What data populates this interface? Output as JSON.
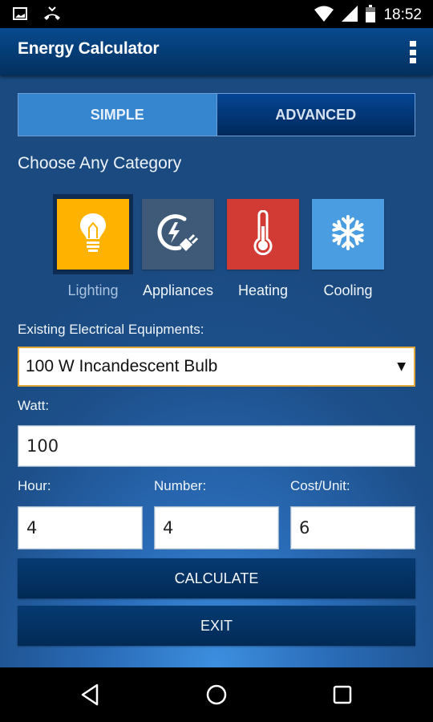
{
  "status_bar": {
    "time": "18:52",
    "left_icons": [
      "image-notification-icon",
      "missed-call-icon"
    ],
    "right_icons": [
      "wifi-icon",
      "signal-icon",
      "battery-icon"
    ]
  },
  "app_bar": {
    "title": "Energy Calculator",
    "menu_icon": "overflow-menu-icon"
  },
  "tabs": [
    {
      "label": "SIMPLE",
      "active": true
    },
    {
      "label": "ADVANCED",
      "active": false
    }
  ],
  "category_section": {
    "heading": "Choose Any Category",
    "categories": [
      {
        "label": "Lighting",
        "icon": "lightbulb-icon",
        "color": "#ffb300",
        "selected": true
      },
      {
        "label": "Appliances",
        "icon": "power-plug-icon",
        "color": "#3e5a78",
        "selected": false
      },
      {
        "label": "Heating",
        "icon": "thermometer-icon",
        "color": "#d23b33",
        "selected": false
      },
      {
        "label": "Cooling",
        "icon": "snowflake-icon",
        "color": "#4a9de0",
        "selected": false
      }
    ]
  },
  "form": {
    "equipment_label": "Existing Electrical Equipments:",
    "equipment_value": "100 W Incandescent Bulb",
    "watt_label": "Watt:",
    "watt_value": "100",
    "hour_label": "Hour:",
    "hour_value": "4",
    "number_label": "Number:",
    "number_value": "4",
    "cost_label": "Cost/Unit:",
    "cost_value": "6"
  },
  "buttons": {
    "calculate": "CALCULATE",
    "exit": "EXIT"
  },
  "nav_bar": {
    "items": [
      "back-icon",
      "home-icon",
      "recents-icon"
    ]
  },
  "colors": {
    "app_bar": "#064a8e",
    "tab_active": "#3585cf",
    "button": "#053a72",
    "select_border": "#e0a83c"
  }
}
